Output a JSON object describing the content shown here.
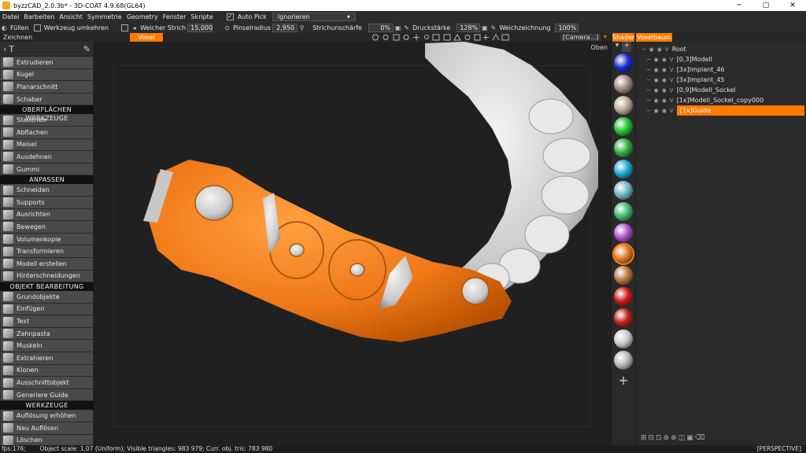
{
  "window": {
    "title": "byzzCAD_2.0.3b* - 3D-COAT 4.9.68(GL64)",
    "controls": [
      "─",
      "▢",
      "✕"
    ]
  },
  "menu": {
    "items": [
      "Datei",
      "Barbeiten",
      "Ansicht",
      "Symmetrie",
      "Geometry",
      "Fenster",
      "Skripte"
    ],
    "auto_pick_label": "Auto Pick",
    "auto_pick_value": "Ignorieren"
  },
  "toolbar": {
    "fill_label": "Füllen",
    "invert_label": "Werkzeug umkehren",
    "soft_stroke_label": "Weicher Strich",
    "soft_stroke_value": "15,000",
    "brush_radius_label": "Pinselradius",
    "brush_radius_value": "2,950",
    "stroke_sharpness_label": "Strichunschärfe",
    "stroke_sharpness_value": "0%",
    "pressure_label": "Druckstärke",
    "pressure_value": "128%",
    "smoothing_label": "Weichzeichnung",
    "smoothing_value": "100%",
    "camera_value": "[Camera...]"
  },
  "tabs": {
    "zeichnen": "Zeichnen",
    "voxel": "Voxel",
    "shader": "Shader",
    "voxelbaum": "Voxelbaum"
  },
  "tools_group1": [
    "Extrudieren",
    "Kugel",
    "Planarschnitt",
    "Schaber"
  ],
  "section_surface": "OBERFLÄCHEN WERKZEUGE",
  "tools_group2": [
    "Stauchen",
    "Abflachen",
    "Meisel",
    "Ausdehnen",
    "Gummi"
  ],
  "section_adjust": "ANPASSEN",
  "tools_group3": [
    "Schneiden",
    "Supports",
    "Ausrichten",
    "Bewegen",
    "Volumenkopie",
    "Transformieren",
    "Modell erstellen",
    "Hinterschneidungen"
  ],
  "section_object": "OBJEKT BEARBEITUNG",
  "tools_group4": [
    "Grundobjekte",
    "Einfügen",
    "Text",
    "Zahnpasta",
    "Muskeln",
    "Extrahieren",
    "Klonen",
    "Ausschnittobjekt",
    "Generiere Guide"
  ],
  "section_tools": "WERKZEUGE",
  "tools_group5": [
    "Auflösung erhöhen",
    "Neu Auflösen",
    "Löschen"
  ],
  "viewport": {
    "view_label": "Oben"
  },
  "shaders": {
    "colors": [
      "#1a2fd6",
      "#a08a80",
      "#b8a898",
      "#20c030",
      "#30b040",
      "#1aa8d0",
      "#70b8c0",
      "#40b870",
      "#b050c8",
      "#e07a28",
      "#b87840",
      "#d01818",
      "#c02020",
      "#c8c8c8",
      "#b8b8b8"
    ],
    "selected_index": 9
  },
  "tree": {
    "root": "Root",
    "items": [
      {
        "flag": "V",
        "name": "[0,3]Modell"
      },
      {
        "flag": "V",
        "name": "[3x]Implant_46"
      },
      {
        "flag": "V",
        "name": "[3x]Implant_45"
      },
      {
        "flag": "V",
        "name": "[0,9]Modell_Sockel"
      },
      {
        "flag": "V",
        "name": "[1x]Modell_Sockel_copy000"
      },
      {
        "flag": "V",
        "name": "[1x]Guide"
      }
    ],
    "root_flag": "V",
    "selected_index": 5
  },
  "status": {
    "fps": "fps:176;",
    "info": "Object scale: 1,07 (Uniform); Visible triangles: 983 979; Curr. obj. tris: 783 980",
    "projection": "[PERSPECTIVE]"
  }
}
